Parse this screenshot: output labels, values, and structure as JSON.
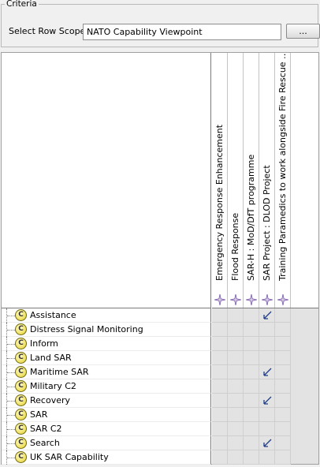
{
  "criteria": {
    "title": "Criteria",
    "row_scope_label": "Select Row Scope:",
    "row_scope_value": "NATO Capability Viewpoint",
    "browse_label": "..."
  },
  "matrix": {
    "columns": [
      {
        "label": "Emergency Response Enhancement",
        "icon": "activity-star-icon"
      },
      {
        "label": "Flood Response",
        "icon": "activity-star-icon"
      },
      {
        "label": "SAR-H : MoD/DfT programme",
        "icon": "activity-star-icon"
      },
      {
        "label": "SAR Project : DLOD Project",
        "icon": "activity-star-icon"
      },
      {
        "label": "Training Paramedics to  work alongside Fire Rescue Service ...",
        "icon": "activity-star-icon"
      }
    ],
    "rows": [
      {
        "label": "Assistance",
        "icon": "capability-icon",
        "icon_letter": "C",
        "marks": [
          3
        ]
      },
      {
        "label": "Distress Signal Monitoring",
        "icon": "capability-icon",
        "icon_letter": "C",
        "marks": []
      },
      {
        "label": "Inform",
        "icon": "capability-icon",
        "icon_letter": "C",
        "marks": []
      },
      {
        "label": "Land SAR",
        "icon": "capability-icon",
        "icon_letter": "C",
        "marks": []
      },
      {
        "label": "Maritime SAR",
        "icon": "capability-icon",
        "icon_letter": "C",
        "marks": [
          3
        ]
      },
      {
        "label": "Military C2",
        "icon": "capability-icon",
        "icon_letter": "C",
        "marks": []
      },
      {
        "label": "Recovery",
        "icon": "capability-icon",
        "icon_letter": "C",
        "marks": [
          3
        ]
      },
      {
        "label": "SAR",
        "icon": "capability-icon",
        "icon_letter": "C",
        "marks": []
      },
      {
        "label": "SAR C2",
        "icon": "capability-icon",
        "icon_letter": "C",
        "marks": []
      },
      {
        "label": "Search",
        "icon": "capability-icon",
        "icon_letter": "C",
        "marks": [
          3
        ]
      },
      {
        "label": "UK SAR Capability",
        "icon": "capability-icon",
        "icon_letter": "C",
        "marks": []
      }
    ],
    "mark_icon": "relationship-arrow-icon",
    "colors": {
      "cell_bg": "#e3e3e3",
      "arrow": "#1f3f8a",
      "star": "#7a5aa8"
    }
  }
}
